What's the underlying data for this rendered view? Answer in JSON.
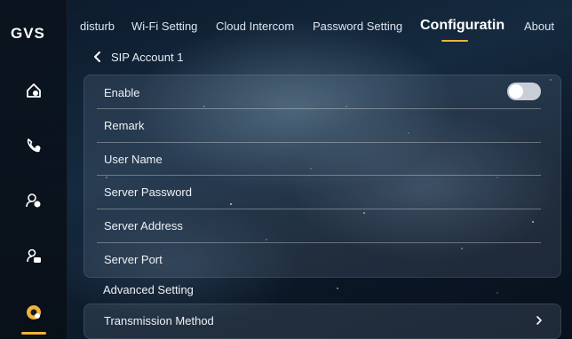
{
  "sidebar": {
    "logo": "GVS",
    "items": [
      {
        "icon": "home-icon"
      },
      {
        "icon": "phone-call-icon"
      },
      {
        "icon": "user-settings-icon"
      },
      {
        "icon": "user-lock-icon"
      },
      {
        "icon": "gear-active-icon"
      }
    ],
    "accent_color": "#f0b23a"
  },
  "tabs": [
    {
      "label": "disturb"
    },
    {
      "label": "Wi-Fi Setting"
    },
    {
      "label": "Cloud Intercom"
    },
    {
      "label": "Password Setting"
    },
    {
      "label": "Configuratin",
      "active": true
    },
    {
      "label": "About"
    }
  ],
  "header": {
    "back_label": "SIP Account 1"
  },
  "settings": {
    "rows": [
      {
        "label": "Enable",
        "toggle": false
      },
      {
        "label": "Remark"
      },
      {
        "label": "User Name"
      },
      {
        "label": "Server Password"
      },
      {
        "label": "Server Address"
      },
      {
        "label": "Server Port"
      }
    ]
  },
  "advanced": {
    "title": "Advanced Setting",
    "transmission_label": "Transmission Method"
  }
}
